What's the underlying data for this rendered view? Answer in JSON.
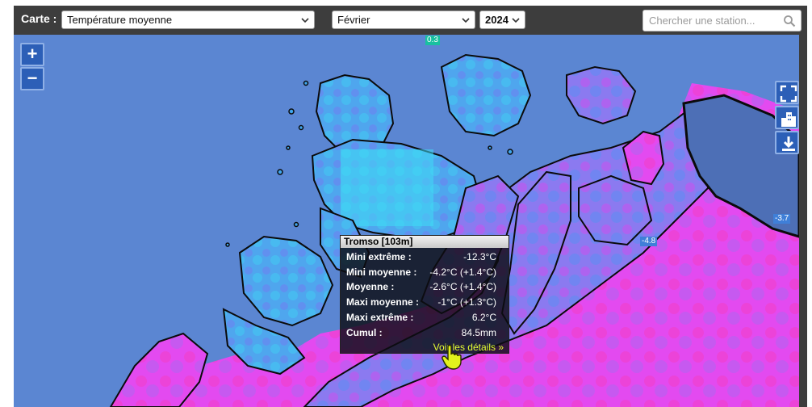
{
  "toolbar": {
    "label": "Carte :",
    "variable": "Température moyenne",
    "month": "Février",
    "year": "2024",
    "search_placeholder": "Chercher une station..."
  },
  "map": {
    "zoom_in": "+",
    "zoom_out": "−",
    "value_labels": [
      {
        "text": "0.3"
      },
      {
        "text": "-4.8"
      },
      {
        "text": "-3.7"
      }
    ],
    "tools": [
      "fullscreen-icon",
      "city-icon",
      "download-icon"
    ],
    "colors": {
      "sea": "#5b86d2",
      "cold_land": "#3fb8f0",
      "mild_land": "#e43ef0"
    }
  },
  "tooltip": {
    "title": "Tromso [103m]",
    "rows": [
      {
        "label": "Mini extrême :",
        "value": "-12.3°C"
      },
      {
        "label": "Mini moyenne :",
        "value": "-4.2°C (+1.4°C)"
      },
      {
        "label": "Moyenne :",
        "value": "-2.6°C (+1.4°C)"
      },
      {
        "label": "Maxi moyenne :",
        "value": "-1°C (+1.3°C)"
      },
      {
        "label": "Maxi extrême :",
        "value": "6.2°C"
      },
      {
        "label": "Cumul :",
        "value": "84.5mm"
      }
    ],
    "link": "Voir les détails »"
  }
}
